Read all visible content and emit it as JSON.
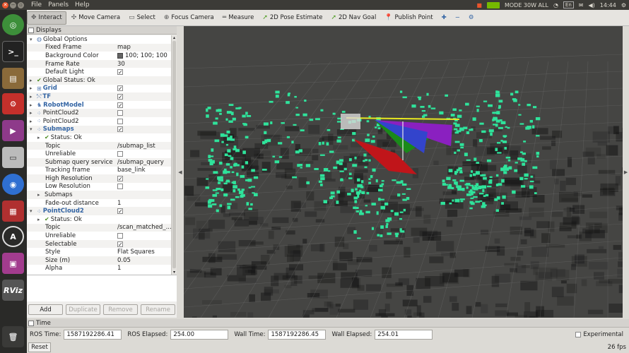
{
  "menubar": {
    "menus": [
      "File",
      "Panels",
      "Help"
    ]
  },
  "tray": {
    "mode": "MODE 30W ALL",
    "lang": "En",
    "time": "14:44"
  },
  "toolbar": {
    "tools": [
      {
        "label": "Interact",
        "icon": "interact-icon",
        "active": true
      },
      {
        "label": "Move Camera",
        "icon": "move-camera-icon"
      },
      {
        "label": "Select",
        "icon": "select-icon"
      },
      {
        "label": "Focus Camera",
        "icon": "focus-camera-icon"
      },
      {
        "label": "Measure",
        "icon": "measure-icon"
      },
      {
        "label": "2D Pose Estimate",
        "icon": "pose-estimate-icon"
      },
      {
        "label": "2D Nav Goal",
        "icon": "nav-goal-icon"
      },
      {
        "label": "Publish Point",
        "icon": "publish-point-icon"
      }
    ]
  },
  "displays": {
    "title": "Displays",
    "rows": [
      {
        "label": "Global Options",
        "indent": 0,
        "arrow": "▾",
        "icon": "globe",
        "value": ""
      },
      {
        "label": "Fixed Frame",
        "indent": 2,
        "value": "map"
      },
      {
        "label": "Background Color",
        "indent": 2,
        "value": "100; 100; 100",
        "swatch": true
      },
      {
        "label": "Frame Rate",
        "indent": 2,
        "value": "30"
      },
      {
        "label": "Default Light",
        "indent": 2,
        "check": true
      },
      {
        "label": "Global Status: Ok",
        "indent": 0,
        "arrow": "▸",
        "ok": true
      },
      {
        "label": "Grid",
        "indent": 0,
        "arrow": "▸",
        "icon": "grid",
        "bold": true,
        "check": true
      },
      {
        "label": "TF",
        "indent": 0,
        "arrow": "▸",
        "icon": "tf",
        "bold": true,
        "check": true
      },
      {
        "label": "RobotModel",
        "indent": 0,
        "arrow": "▸",
        "icon": "robot",
        "bold": true,
        "check": true
      },
      {
        "label": "PointCloud2",
        "indent": 0,
        "arrow": "▸",
        "icon": "cloud",
        "check": false
      },
      {
        "label": "PointCloud2",
        "indent": 0,
        "arrow": "▸",
        "icon": "cloud",
        "check": false
      },
      {
        "label": "Submaps",
        "indent": 0,
        "arrow": "▾",
        "icon": "cloud",
        "bold": true,
        "check": true
      },
      {
        "label": "Status: Ok",
        "indent": 1,
        "arrow": "▸",
        "ok": true
      },
      {
        "label": "Topic",
        "indent": 2,
        "value": "/submap_list"
      },
      {
        "label": "Unreliable",
        "indent": 2,
        "check": false
      },
      {
        "label": "Submap query service",
        "indent": 2,
        "value": "/submap_query"
      },
      {
        "label": "Tracking frame",
        "indent": 2,
        "value": "base_link"
      },
      {
        "label": "High Resolution",
        "indent": 2,
        "check": true
      },
      {
        "label": "Low Resolution",
        "indent": 2,
        "check": false
      },
      {
        "label": "Submaps",
        "indent": 1,
        "arrow": "▸"
      },
      {
        "label": "Fade-out distance",
        "indent": 2,
        "value": "1"
      },
      {
        "label": "PointCloud2",
        "indent": 0,
        "arrow": "▾",
        "icon": "cloud",
        "bold": true,
        "check": true
      },
      {
        "label": "Status: Ok",
        "indent": 1,
        "arrow": "▸",
        "ok": true
      },
      {
        "label": "Topic",
        "indent": 2,
        "value": "/scan_matched_..."
      },
      {
        "label": "Unreliable",
        "indent": 2,
        "check": false
      },
      {
        "label": "Selectable",
        "indent": 2,
        "check": true
      },
      {
        "label": "Style",
        "indent": 2,
        "value": "Flat Squares"
      },
      {
        "label": "Size (m)",
        "indent": 2,
        "value": "0.05"
      },
      {
        "label": "Alpha",
        "indent": 2,
        "value": "1"
      }
    ],
    "buttons": [
      {
        "label": "Add",
        "enabled": true
      },
      {
        "label": "Duplicate",
        "enabled": false
      },
      {
        "label": "Remove",
        "enabled": false
      },
      {
        "label": "Rename",
        "enabled": false
      }
    ]
  },
  "time": {
    "title": "Time",
    "ros_time_label": "ROS Time:",
    "ros_time": "1587192286.41",
    "ros_elapsed_label": "ROS Elapsed:",
    "ros_elapsed": "254.00",
    "wall_time_label": "Wall Time:",
    "wall_time": "1587192286.45",
    "wall_elapsed_label": "Wall Elapsed:",
    "wall_elapsed": "254.01",
    "experimental_label": "Experimental",
    "reset_label": "Reset",
    "fps": "26 fps"
  },
  "launcher": {
    "items": [
      "ubuntu-dash-icon",
      "terminal-icon",
      "files-icon",
      "settings-icon",
      "video-icon",
      "drive-icon",
      "chromium-icon",
      "system-monitor-icon",
      "software-updater-icon",
      "remote-desktop-icon",
      "rviz-icon",
      "trash-icon"
    ],
    "rviz_text": "RViz"
  },
  "colors": {
    "cloud": "#2fe39b",
    "accent": "#e9542b",
    "viewport_bg": "#454543"
  }
}
